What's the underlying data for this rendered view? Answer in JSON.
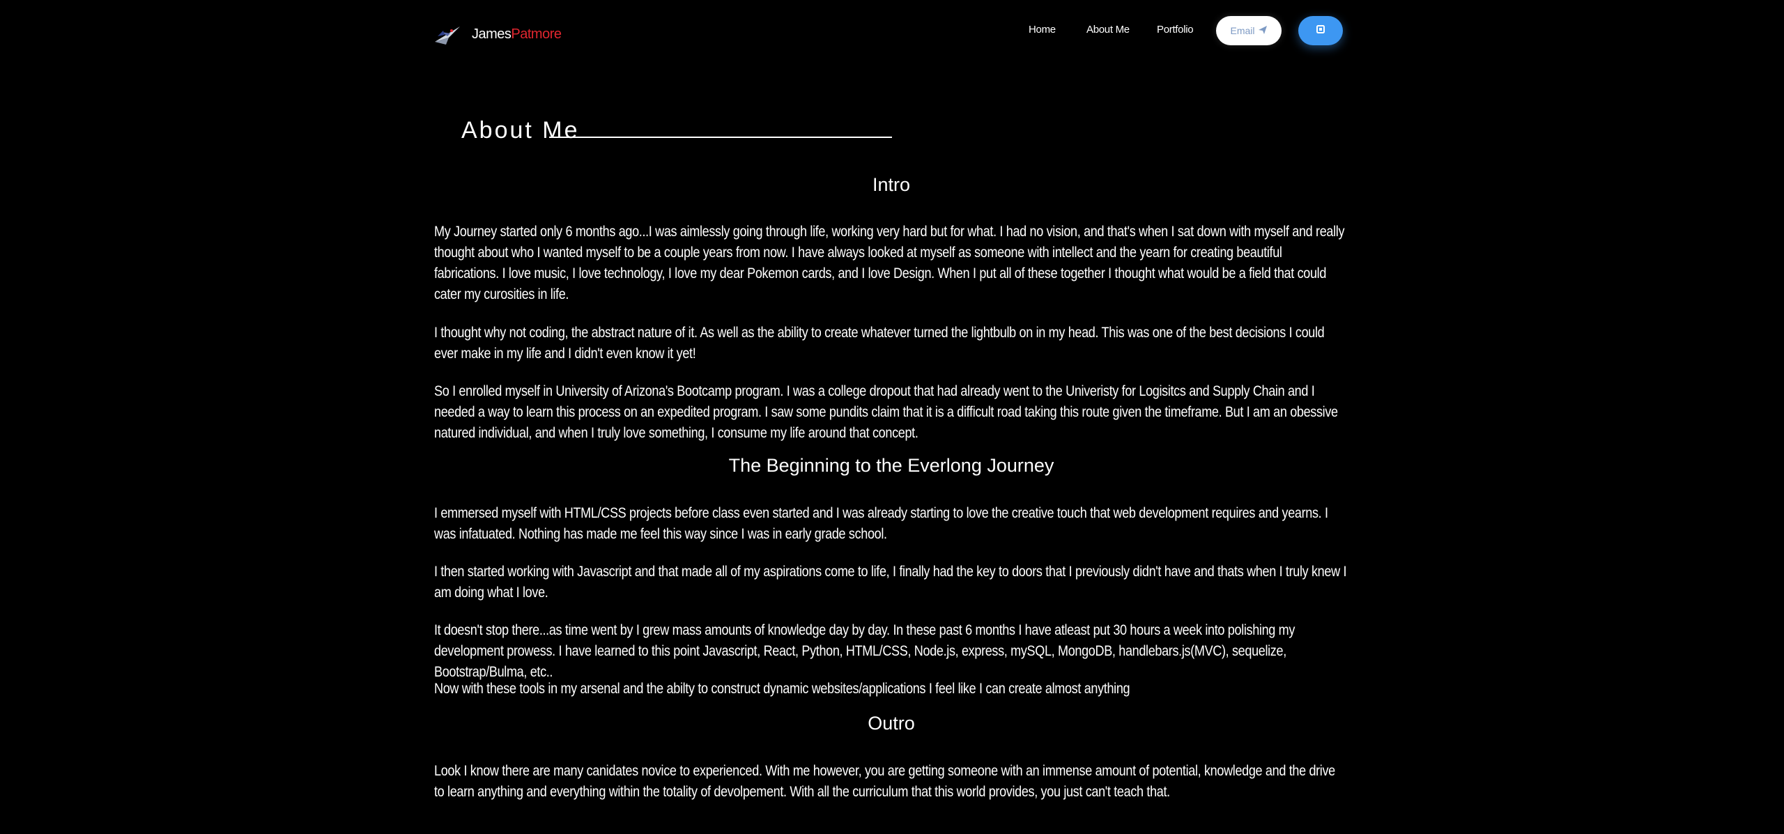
{
  "nav": {
    "brand_first": "James",
    "brand_last": "Patmore",
    "links": [
      "Home",
      "About Me",
      "Portfolio"
    ],
    "email_label": "Email",
    "logo_icon": "jet-logo-icon",
    "email_icon": "paper-plane-icon",
    "cta_icon": "square-icon"
  },
  "colors": {
    "background": "#000000",
    "brand_accent": "#e0262f",
    "cta": "#3d97f2"
  },
  "page": {
    "title": "About Me"
  },
  "sections": {
    "intro": {
      "heading": "Intro",
      "paragraphs": [
        "My Journey started only 6 months ago...I was aimlessly going through life, working very hard but for what. I had no vision, and that's when I sat down with myself and really thought about who I wanted myself to be a couple years from now. I have always looked at myself as someone with intellect and the yearn for creating beautiful fabrications. I love music, I love technology, I love my dear Pokemon cards, and I love Design. When I put all of these together I thought what would be a field that could cater my curosities in life.",
        "I thought why not coding, the abstract nature of it. As well as the ability to create whatever turned the lightbulb on in my head. This was one of the best decisions I could ever make in my life and I didn't even know it yet!",
        "So I enrolled myself in University of Arizona's Bootcamp program. I was a college dropout that had already went to the Univeristy for Logisitcs and Supply Chain and I needed a way to learn this process on an expedited program. I saw some pundits claim that it is a difficult road taking this route given the timeframe. But I am an obessive natured individual, and when I truly love something, I consume my life around that concept."
      ]
    },
    "beginning": {
      "heading": "The Beginning to the Everlong Journey",
      "paragraphs": [
        "I emmersed myself with HTML/CSS projects before class even started and I was already starting to love the creative touch that web development requires and yearns. I was infatuated. Nothing has made me feel this way since I was in early grade school.",
        "I then started working with Javascript and that made all of my aspirations come to life, I finally had the key to doors that I previously didn't have and thats when I truly knew I am doing what I love.",
        "It doesn't stop there...as time went by I grew mass amounts of knowledge day by day. In these past 6 months I have atleast put 30 hours a week into polishing my development prowess. I have learned to this point Javascript, React, Python, HTML/CSS, Node.js, express, mySQL, MongoDB, handlebars.js(MVC), sequelize, Bootstrap/Bulma, etc..",
        "Now with these tools in my arsenal and the abilty to construct dynamic websites/applications I feel like I can create almost anything"
      ]
    },
    "outro": {
      "heading": "Outro",
      "paragraphs": [
        "Look I know there are many canidates novice to experienced. With me however, you are getting someone with an immense amount of potential, knowledge and the drive to learn anything and everything within the totality of devolpement. With all the curriculum that this world provides, you just can't teach that."
      ]
    }
  }
}
